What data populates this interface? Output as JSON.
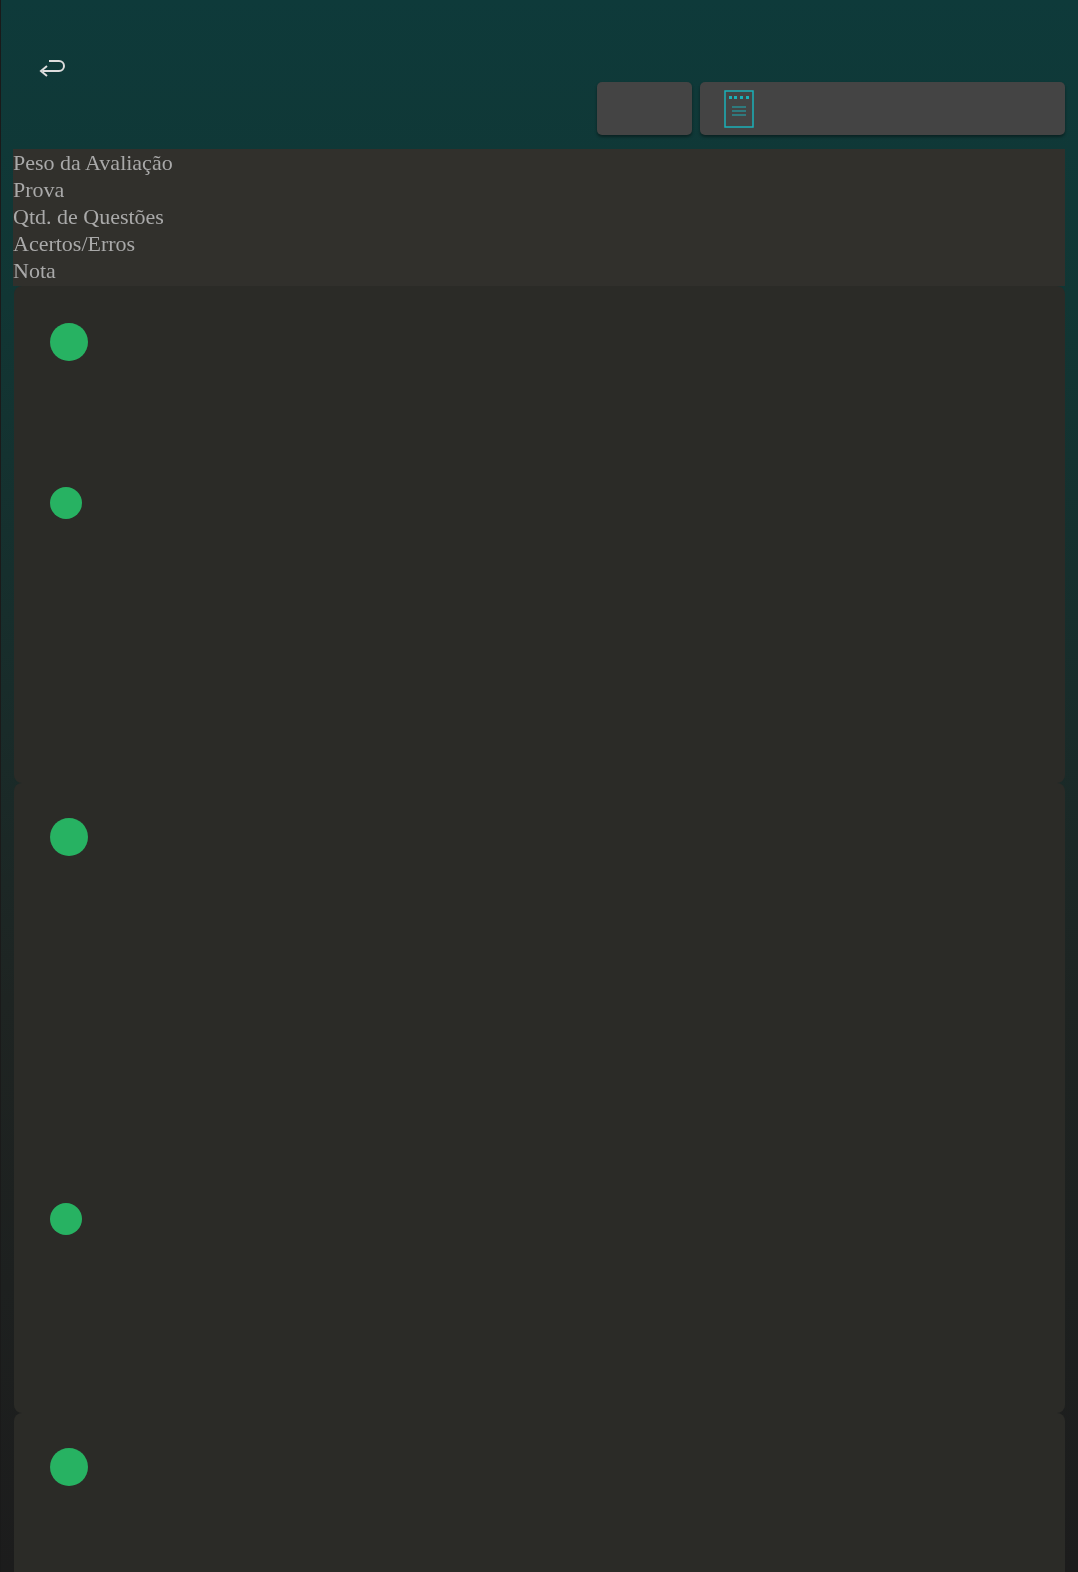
{
  "header_labels": [
    "Peso da Avaliação",
    "Prova",
    "Qtd. de Questões",
    "Acertos/Erros",
    "Nota"
  ],
  "cards": [
    {
      "kind": "pair"
    },
    {
      "kind": "pair"
    },
    {
      "kind": "single"
    }
  ]
}
